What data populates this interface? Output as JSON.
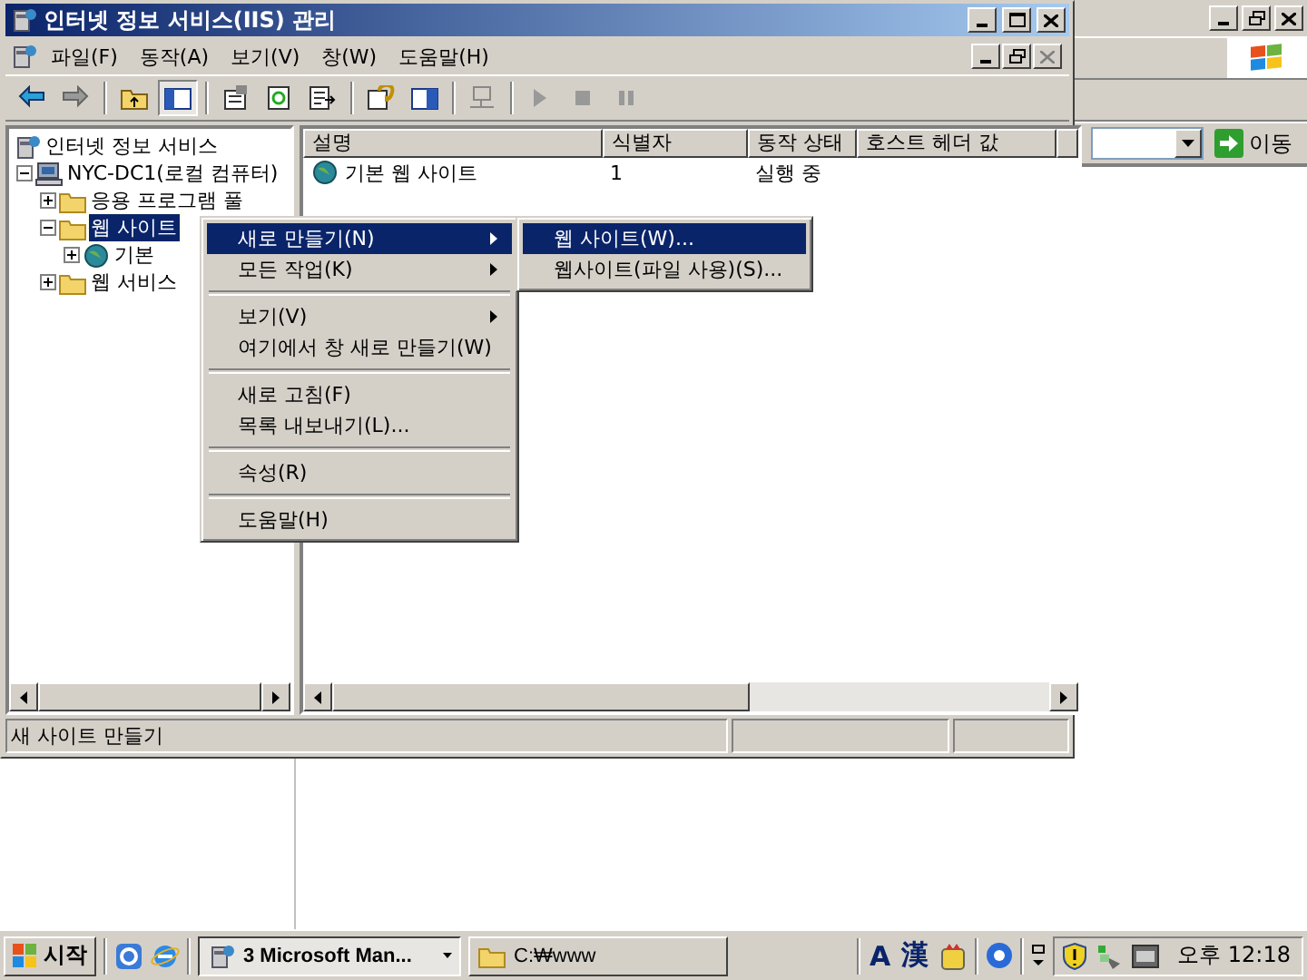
{
  "background_window": {
    "address_button": "이동"
  },
  "window": {
    "title": "인터넷 정보 서비스(IIS) 관리"
  },
  "menu_bar": [
    "파일(F)",
    "동작(A)",
    "보기(V)",
    "창(W)",
    "도움말(H)"
  ],
  "tree": [
    {
      "label": "인터넷 정보 서비스",
      "kind": "services",
      "selected": false,
      "children": [
        {
          "label": "NYC-DC1(로컬 컴퓨터)",
          "kind": "computer",
          "expanded": true,
          "selected": false,
          "children": [
            {
              "label": "응용 프로그램 풀",
              "kind": "folder",
              "expanded": false,
              "selected": false
            },
            {
              "label": "웹 사이트",
              "kind": "folder",
              "expanded": true,
              "selected": true,
              "children": [
                {
                  "label": "기본",
                  "kind": "site",
                  "expanded": false,
                  "selected": false
                }
              ]
            },
            {
              "label": "웹 서비스",
              "kind": "folder",
              "expanded": false,
              "selected": false
            }
          ]
        }
      ]
    }
  ],
  "list": {
    "columns": [
      "설명",
      "식별자",
      "동작 상태",
      "호스트 헤더 값"
    ],
    "rows": [
      {
        "cells": [
          "기본 웹 사이트",
          "1",
          "실행 중"
        ]
      }
    ]
  },
  "context_menu": {
    "items": [
      {
        "kind": "item",
        "label": "새로 만들기(N)",
        "submenu": true,
        "selected": true
      },
      {
        "kind": "item",
        "label": "모든 작업(K)",
        "submenu": true,
        "selected": false
      },
      {
        "kind": "separator"
      },
      {
        "kind": "item",
        "label": "보기(V)",
        "submenu": true,
        "selected": false
      },
      {
        "kind": "item",
        "label": "여기에서 창 새로 만들기(W)",
        "selected": false
      },
      {
        "kind": "separator"
      },
      {
        "kind": "item",
        "label": "새로 고침(F)",
        "selected": false
      },
      {
        "kind": "item",
        "label": "목록 내보내기(L)...",
        "selected": false
      },
      {
        "kind": "separator"
      },
      {
        "kind": "item",
        "label": "속성(R)",
        "selected": false
      },
      {
        "kind": "separator"
      },
      {
        "kind": "item",
        "label": "도움말(H)",
        "selected": false
      }
    ]
  },
  "submenu": {
    "items": [
      {
        "kind": "item",
        "label": "웹 사이트(W)...",
        "selected": true
      },
      {
        "kind": "item",
        "label": "웹사이트(파일 사용)(S)...",
        "selected": false
      }
    ]
  },
  "status_bar": {
    "text": "새 사이트 만들기"
  },
  "taskbar": {
    "start": "시작",
    "tasks": [
      {
        "kind": "group",
        "label": "3 Microsoft Man...",
        "selected": true
      },
      {
        "kind": "folder",
        "label": "C:₩www",
        "selected": false
      }
    ],
    "ime": [
      "A",
      "漢"
    ],
    "clock": "오후 12:18"
  }
}
